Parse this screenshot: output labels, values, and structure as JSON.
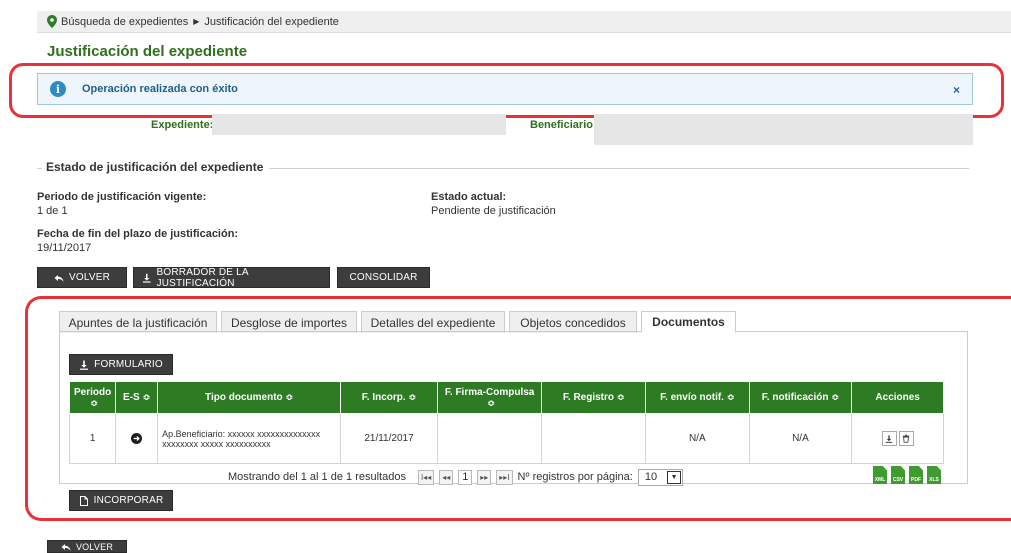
{
  "breadcrumb": {
    "items": [
      "Búsqueda de expedientes",
      "Justificación del expediente"
    ]
  },
  "page_title": "Justificación del expediente",
  "alert": {
    "message": "Operación realizada con éxito",
    "close_glyph": "×"
  },
  "expediente": {
    "expediente_label": "Expediente:",
    "beneficiario_label": "Beneficiario:"
  },
  "estado": {
    "legend": "Estado de justificación del expediente",
    "periodo_label": "Periodo de justificación vigente:",
    "periodo_value": "1 de 1",
    "estado_label": "Estado actual:",
    "estado_value": "Pendiente de justificación",
    "fecha_label": "Fecha de fin del plazo de justificación:",
    "fecha_value": "19/11/2017"
  },
  "buttons": {
    "volver": "VOLVER",
    "borrador": "BORRADOR DE LA JUSTIFICACIÓN",
    "consolidar": "CONSOLIDAR",
    "formulario": "FORMULARIO",
    "incorporar": "INCORPORAR",
    "volver_bottom": "VOLVER"
  },
  "tabs": [
    {
      "label": "Apuntes de la justificación"
    },
    {
      "label": "Desglose de importes"
    },
    {
      "label": "Detalles del expediente"
    },
    {
      "label": "Objetos concedidos"
    },
    {
      "label": "Documentos"
    }
  ],
  "table": {
    "headers": [
      "Periodo",
      "E-S",
      "Tipo documento",
      "F. Incorp.",
      "F. Firma-Compulsa",
      "F. Registro",
      "F. envío notif.",
      "F. notificación",
      "Acciones"
    ],
    "sort_glyph": "≎",
    "rows": [
      {
        "periodo": "1",
        "tipo_documento": "Ap.Beneficiario: xxxxxx xxxxxxxxxxxxxx xxxxxxxx xxxxx xxxxxxxxxx",
        "f_incorp": "21/11/2017",
        "f_firma": "",
        "f_registro": "",
        "f_envio": "N/A",
        "f_notificacion": "N/A"
      }
    ]
  },
  "pagination": {
    "summary": "Mostrando del 1 al 1 de 1 resultados",
    "current_page": "1",
    "page_size_label": "Nº registros por página:",
    "page_size": "10"
  },
  "exports": [
    "XML",
    "CSV",
    "PDF",
    "XLS"
  ],
  "colors": {
    "primary_green": "#2d7c23",
    "title_green": "#2f6f1e",
    "alert_ring": "#e8323a",
    "info_blue": "#2f8bc6",
    "dark_button": "#3d3d3d"
  }
}
